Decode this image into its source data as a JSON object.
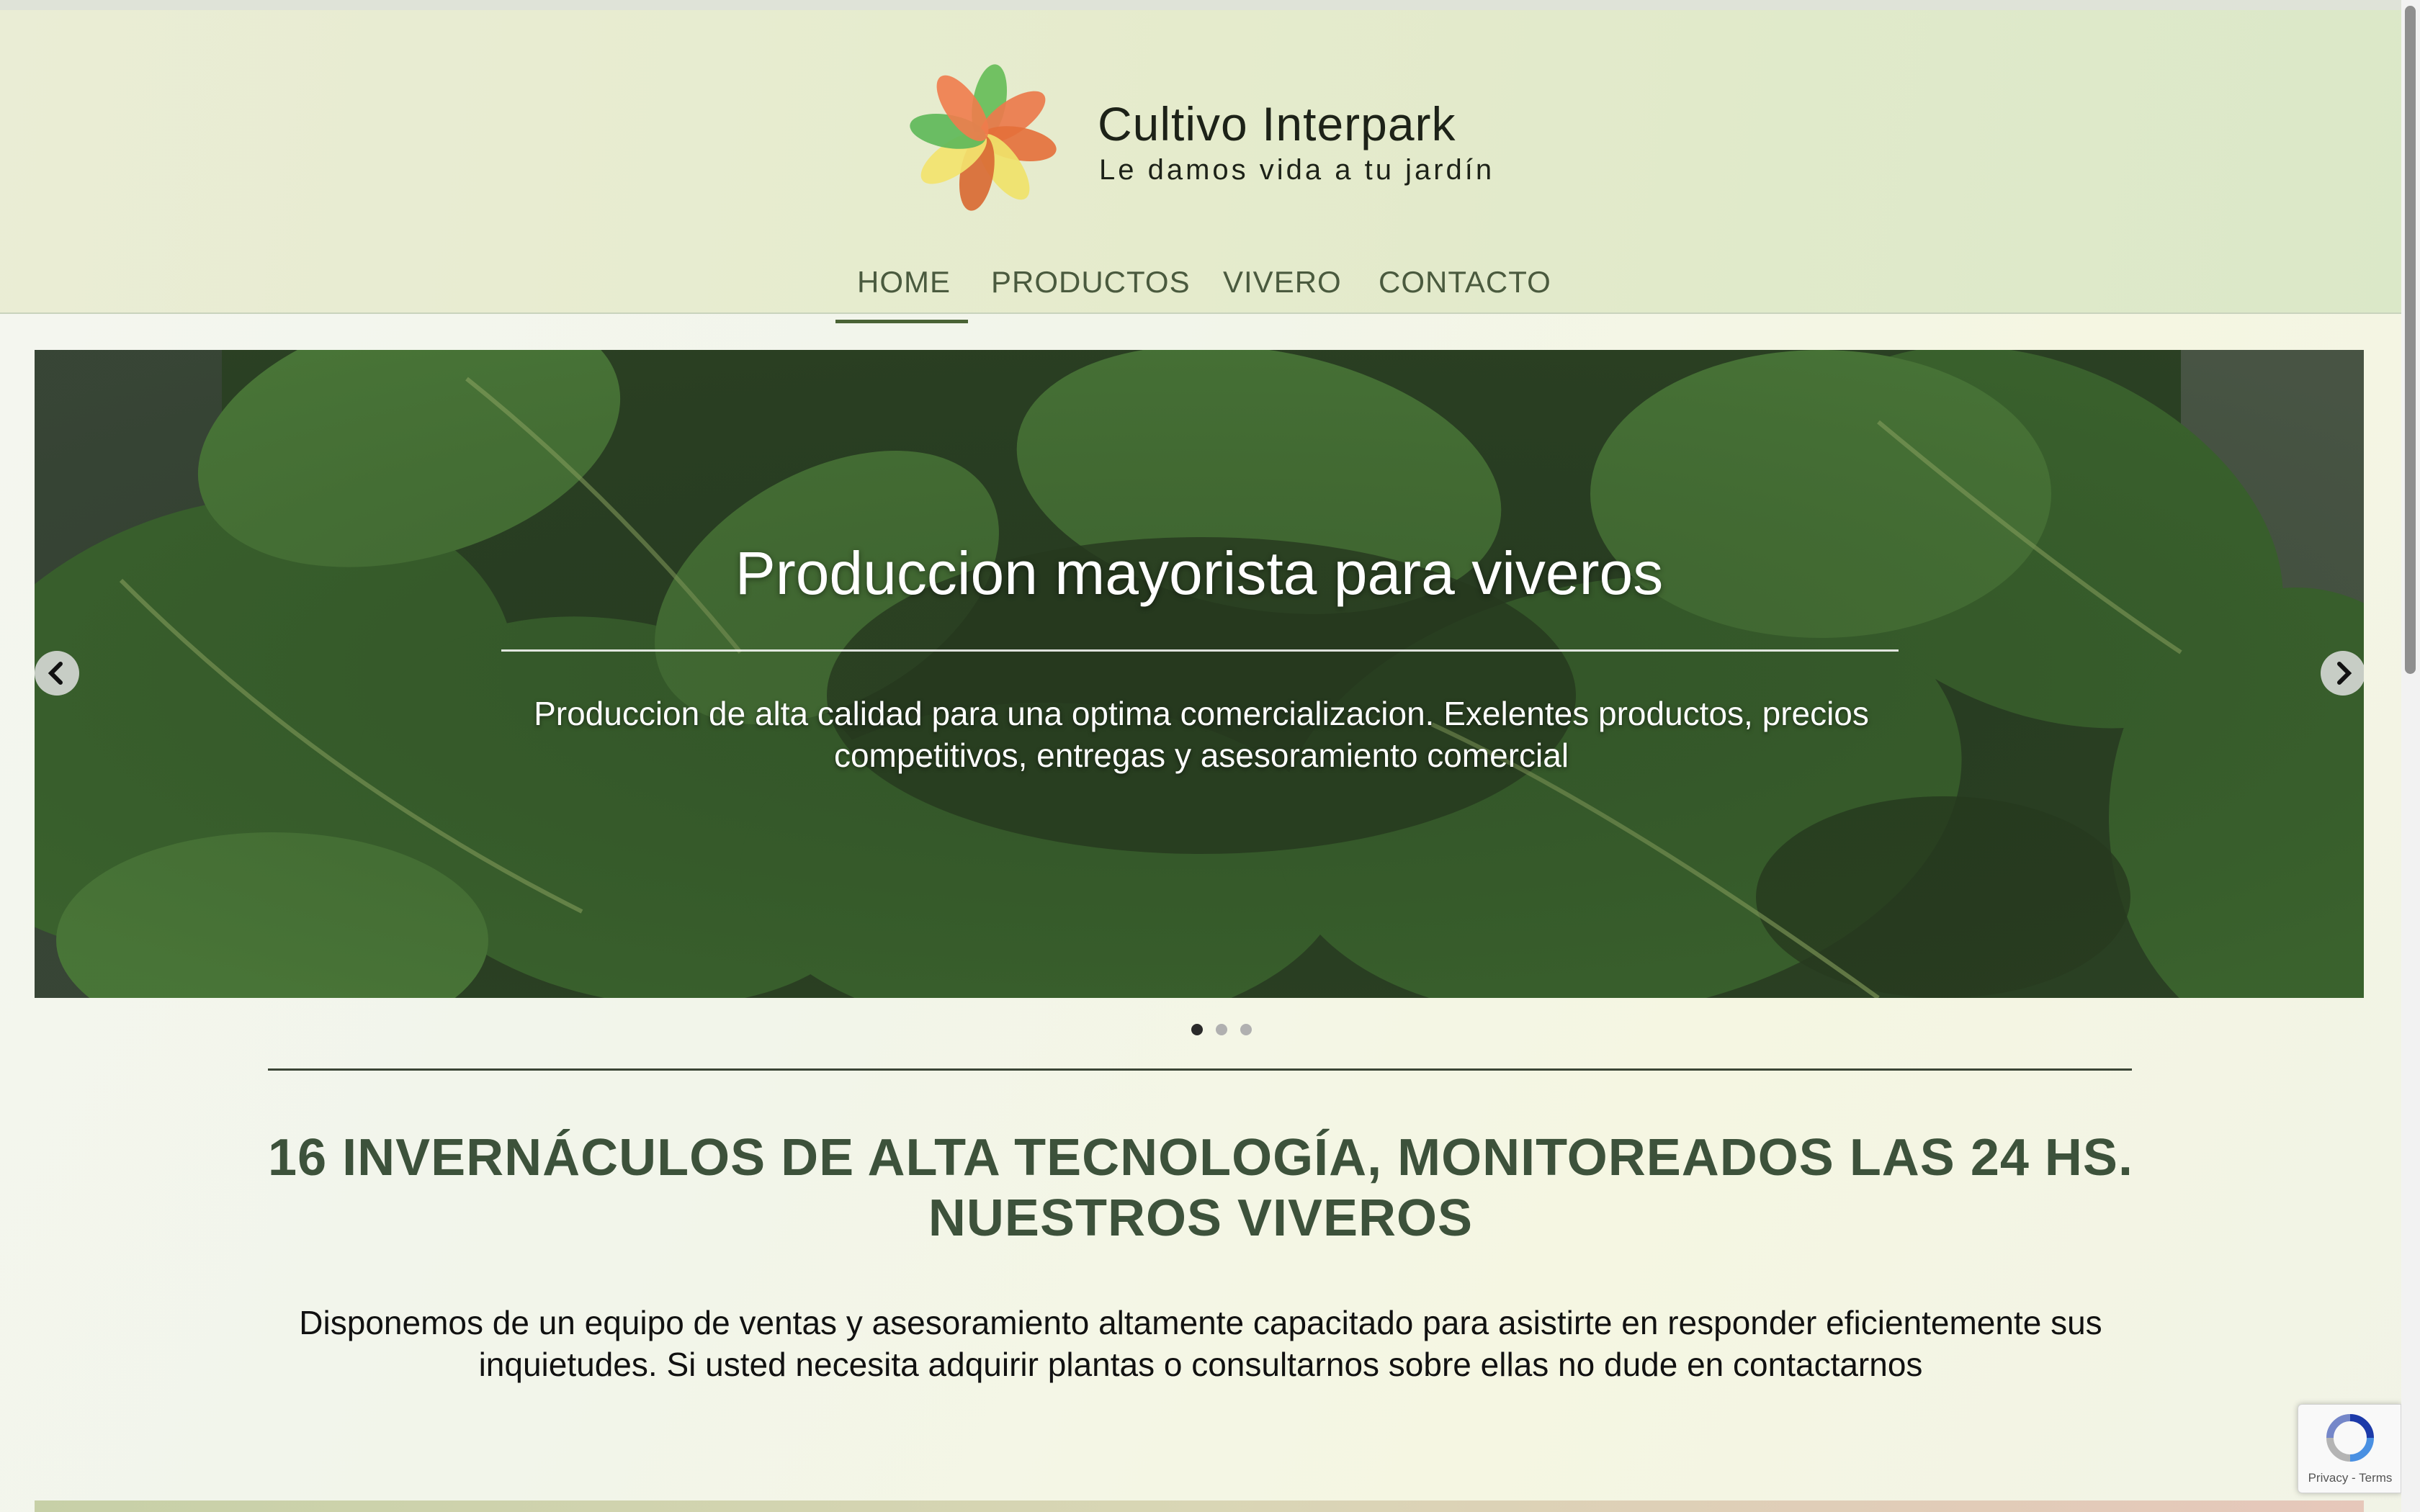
{
  "brand": {
    "title": "Cultivo Interpark",
    "tagline": "Le damos vida a tu jardín",
    "logo_icon": "flower-logo-icon"
  },
  "nav": {
    "items": [
      {
        "label": "HOME",
        "active": true
      },
      {
        "label": "PRODUCTOS",
        "active": false
      },
      {
        "label": "VIVERO",
        "active": false
      },
      {
        "label": "CONTACTO",
        "active": false
      }
    ]
  },
  "slider": {
    "title": "Produccion mayorista para viveros",
    "text": "Produccion de alta calidad para una optima comercializacion. Exelentes productos, precios competitivos, entregas y asesoramiento comercial",
    "prev_icon": "chevron-left-icon",
    "next_icon": "chevron-right-icon",
    "slide_count": 3,
    "active_slide": 1
  },
  "section": {
    "heading_line1": "16 INVERNÁCULOS DE ALTA TECNOLOGÍA, MONITOREADOS LAS 24 HS.",
    "heading_line2": "NUESTROS VIVEROS",
    "body": "Disponemos de un equipo de ventas y asesoramiento altamente capacitado para asistirte en responder eficientemente sus inquietudes. Si usted necesita adquirir plantas o consultarnos sobre ellas no dude en contactarnos"
  },
  "recaptcha": {
    "links": "Privacy - Terms"
  },
  "colors": {
    "header_bg": "#e5ebcc",
    "nav_text": "#4a5a3e",
    "heading_green": "#3d523b",
    "logo_green": "#5db95a",
    "logo_orange": "#e9774a",
    "logo_yellow": "#f2e46a"
  }
}
